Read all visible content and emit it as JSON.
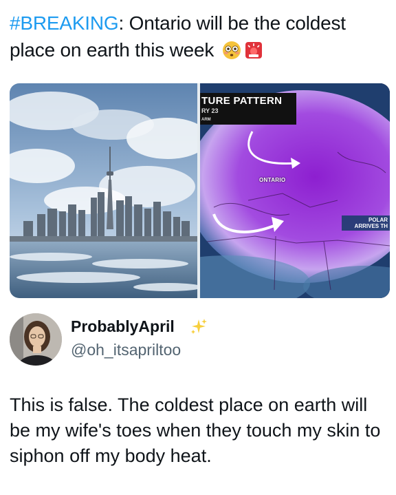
{
  "post": {
    "hashtag": "#BREAKING",
    "headline_text": ": Ontario will be the coldest place on earth this week",
    "emojis": [
      "flushed-face-emoji",
      "police-light-emoji"
    ]
  },
  "media": {
    "left_image": "toronto-skyline-frozen-lake-photo",
    "right_image": "weather-temperature-pattern-map",
    "map_title": "TURE PATTERN",
    "map_subtitle": "RY 23",
    "map_small_label": "ARM",
    "map_region_label": "ONTARIO",
    "map_callout_line1": "POLAR",
    "map_callout_line2": "ARRIVES TH"
  },
  "author": {
    "display_name": "ProbablyApril",
    "handle": "@oh_itsapriltoo",
    "badge": "sparkles-emoji"
  },
  "reply": {
    "text": "This is false. The coldest place on earth will be my wife's toes when they touch my skin to siphon off my body heat."
  },
  "colors": {
    "hashtag": "#1d9bf0",
    "text": "#0f1419",
    "handle": "#536471",
    "map_purple": "#9b2fd6"
  }
}
